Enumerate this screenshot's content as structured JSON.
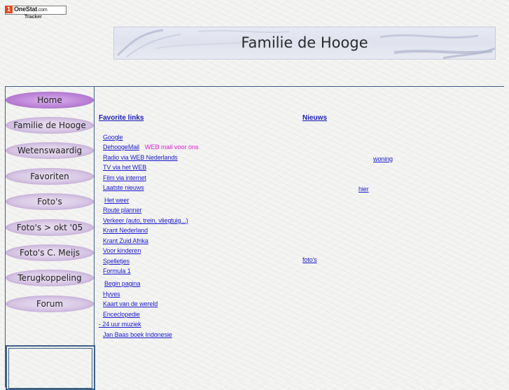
{
  "tracker": {
    "brand_mark": "1",
    "brand": "OneStat",
    "brand_suffix": ".com",
    "sub": "Tracker"
  },
  "banner": {
    "title": "Familie de Hooge"
  },
  "nav": {
    "items": [
      {
        "label": "Home"
      },
      {
        "label": "Familie de Hooge"
      },
      {
        "label": "Wetenswaardig"
      },
      {
        "label": "Favoriten"
      },
      {
        "label": "Foto's"
      },
      {
        "label": "Foto's > okt '05"
      },
      {
        "label": "Foto's C. Meijs"
      },
      {
        "label": "Terugkoppeling"
      },
      {
        "label": "Forum"
      }
    ]
  },
  "favorites": {
    "heading": "Favorite links",
    "links": [
      "Google",
      "DehoogeMail",
      "Radio via WEB Nederlands",
      "TV via het WEB",
      "Film via internet",
      "Laatste nieuws",
      "Het weer",
      "Route planner",
      "Verkeer (auto, trein, vliegtuig...)",
      "Krant Nederland",
      "Krant Zuid Afrika",
      "Voor kinderen",
      "Spelletjes",
      "Formula 1",
      "Begin pagina",
      "Hyves",
      "Kaart van de wereld",
      "Enceclopedie",
      "- 24 uur muziek",
      "Jan Baas boek Indonesie"
    ],
    "mail_note": "WEB mail voor ons"
  },
  "news": {
    "heading": "Nieuws",
    "links": [
      "woning",
      "hier",
      "foto's"
    ]
  },
  "colors": {
    "accent": "#3d5f86",
    "link": "#1a1ad0",
    "highlight": "#e01bd8",
    "nav_active": "#bd84d8"
  }
}
